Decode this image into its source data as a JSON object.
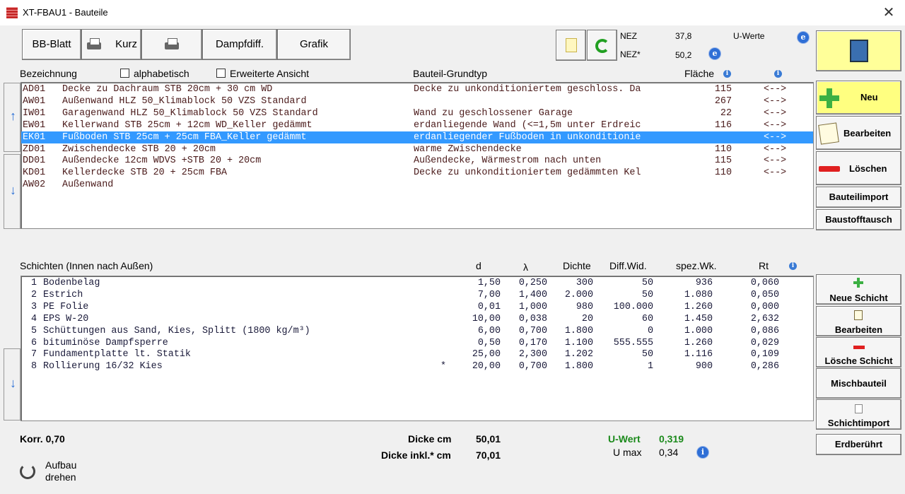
{
  "window": {
    "title": "XT-FBAU1 - Bauteile",
    "close": "✕"
  },
  "toolbar": {
    "bb_blatt": "BB-Blatt",
    "kurz": "Kurz",
    "dampfdiff": "Dampfdiff.",
    "grafik": "Grafik"
  },
  "nez": {
    "nez_label": "NEZ",
    "nez_value": "37,8",
    "nez_star_label": "NEZ*",
    "nez_star_value": "50,2",
    "u_werte": "U-Werte"
  },
  "sidebar": {
    "neu": "Neu",
    "bearbeiten": "Bearbeiten",
    "loeschen": "Löschen",
    "bauteilimport": "Bauteilimport",
    "baustofftausch": "Baustofftausch",
    "neue_schicht": "Neue Schicht",
    "bearbeiten2": "Bearbeiten",
    "loesche_schicht": "Lösche Schicht",
    "mischbauteil": "Mischbauteil",
    "schichtimport": "Schichtimport",
    "erdberuehrt": "Erdberührt"
  },
  "components_header": {
    "bezeichnung": "Bezeichnung",
    "alphabetisch": "alphabetisch",
    "erweiterte": "Erweiterte Ansicht",
    "grundtyp": "Bauteil-Grundtyp",
    "flaeche": "Fläche"
  },
  "components": [
    {
      "code": "AD01",
      "name": "Decke zu Dachraum STB 20cm + 30 cm WD",
      "type": "Decke zu unkonditioniertem geschloss. Da",
      "area": "115",
      "arrow": "<-->"
    },
    {
      "code": "AW01",
      "name": "Außenwand HLZ 50_Klimablock 50 VZS Standard",
      "type": "",
      "area": "267",
      "arrow": "<-->"
    },
    {
      "code": "IW01",
      "name": "Garagenwand HLZ 50_Klimablock 50 VZS Standard",
      "type": "Wand zu geschlossener Garage",
      "area": "22",
      "arrow": "<-->"
    },
    {
      "code": "EW01",
      "name": "Kellerwand STB 25cm + 12cm WD_Keller gedämmt",
      "type": "erdanliegende Wand (<=1,5m unter Erdreic",
      "area": "116",
      "arrow": "<-->"
    },
    {
      "code": "EK01",
      "name": "Fußboden STB 25cm + 25cm FBA_Keller gedämmt",
      "type": "erdanliegender Fußboden in unkonditionie",
      "area": "",
      "arrow": "<-->"
    },
    {
      "code": "ZD01",
      "name": "Zwischendecke STB 20 + 20cm",
      "type": "warme Zwischendecke",
      "area": "110",
      "arrow": "<-->"
    },
    {
      "code": "DD01",
      "name": "Außendecke 12cm WDVS +STB 20 + 20cm",
      "type": "Außendecke, Wärmestrom nach unten",
      "area": "115",
      "arrow": "<-->"
    },
    {
      "code": "KD01",
      "name": "Kellerdecke STB 20 + 25cm FBA",
      "type": "Decke zu unkonditioniertem gedämmten Kel",
      "area": "110",
      "arrow": "<-->"
    },
    {
      "code": "AW02",
      "name": "Außenwand",
      "type": "",
      "area": "",
      "arrow": ""
    }
  ],
  "layers_header": {
    "schichten": "Schichten (Innen nach Außen)",
    "d": "d",
    "lambda": "λ",
    "dichte": "Dichte",
    "diffwid": "Diff.Wid.",
    "spezwk": "spez.Wk.",
    "rt": "Rt"
  },
  "layers": [
    {
      "no": "1",
      "name": "Bodenbelag",
      "star": "",
      "d": "1,50",
      "lambda": "0,250",
      "dichte": "300",
      "diff": "50",
      "spez": "936",
      "rt": "0,060"
    },
    {
      "no": "2",
      "name": "Estrich",
      "star": "",
      "d": "7,00",
      "lambda": "1,400",
      "dichte": "2.000",
      "diff": "50",
      "spez": "1.080",
      "rt": "0,050"
    },
    {
      "no": "3",
      "name": "PE Folie",
      "star": "",
      "d": "0,01",
      "lambda": "1,000",
      "dichte": "980",
      "diff": "100.000",
      "spez": "1.260",
      "rt": "0,000"
    },
    {
      "no": "4",
      "name": "EPS W-20",
      "star": "",
      "d": "10,00",
      "lambda": "0,038",
      "dichte": "20",
      "diff": "60",
      "spez": "1.450",
      "rt": "2,632"
    },
    {
      "no": "5",
      "name": "Schüttungen aus Sand, Kies, Splitt (1800 kg/m³)",
      "star": "",
      "d": "6,00",
      "lambda": "0,700",
      "dichte": "1.800",
      "diff": "0",
      "spez": "1.000",
      "rt": "0,086"
    },
    {
      "no": "6",
      "name": "bituminöse Dampfsperre",
      "star": "",
      "d": "0,50",
      "lambda": "0,170",
      "dichte": "1.100",
      "diff": "555.555",
      "spez": "1.260",
      "rt": "0,029"
    },
    {
      "no": "7",
      "name": "Fundamentplatte lt. Statik",
      "star": "",
      "d": "25,00",
      "lambda": "2,300",
      "dichte": "1.202",
      "diff": "50",
      "spez": "1.116",
      "rt": "0,109"
    },
    {
      "no": "8",
      "name": "Rollierung 16/32 Kies",
      "star": "*",
      "d": "20,00",
      "lambda": "0,700",
      "dichte": "1.800",
      "diff": "1",
      "spez": "900",
      "rt": "0,286"
    }
  ],
  "footer": {
    "korr": "Korr. 0,70",
    "dicke_label": "Dicke cm",
    "dicke_value": "50,01",
    "dicke_inkl_label": "Dicke inkl.* cm",
    "dicke_inkl_value": "70,01",
    "uwert_label": "U-Wert",
    "uwert_value": "0,319",
    "umax_label": "U max",
    "umax_value": "0,34",
    "aufbau_1": "Aufbau",
    "aufbau_2": "drehen"
  },
  "colors": {
    "selection": "#3399ff",
    "uwert": "#1b8a1b",
    "neu_button": "#ffff80",
    "accent_blue": "#2a6fd6"
  }
}
